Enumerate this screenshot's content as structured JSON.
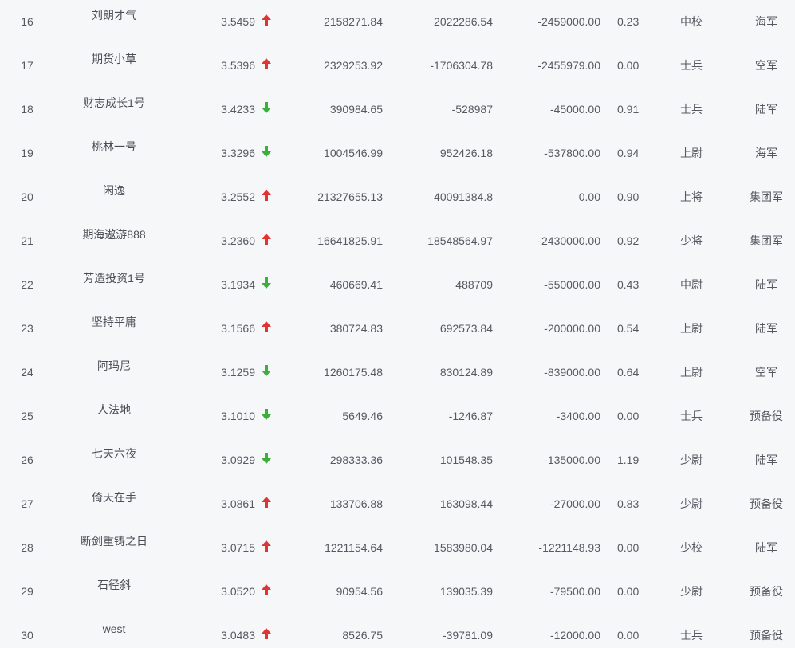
{
  "colors": {
    "up": "#e03434",
    "down": "#3ab03a",
    "text": "#555a61",
    "background": "#f6f7f9"
  },
  "rows": [
    {
      "rank": "16",
      "name": "刘朗才气",
      "score": "3.5459",
      "trend": "up",
      "equity": "2158271.84",
      "profit": "2022286.54",
      "withdraw": "-2459000.00",
      "ratio": "0.23",
      "military_rank": "中校",
      "force": "海军"
    },
    {
      "rank": "17",
      "name": "期货小草",
      "score": "3.5396",
      "trend": "up",
      "equity": "2329253.92",
      "profit": "-1706304.78",
      "withdraw": "-2455979.00",
      "ratio": "0.00",
      "military_rank": "士兵",
      "force": "空军"
    },
    {
      "rank": "18",
      "name": "财志成长1号",
      "score": "3.4233",
      "trend": "down",
      "equity": "390984.65",
      "profit": "-528987",
      "withdraw": "-45000.00",
      "ratio": "0.91",
      "military_rank": "士兵",
      "force": "陆军"
    },
    {
      "rank": "19",
      "name": "桃林一号",
      "score": "3.3296",
      "trend": "down",
      "equity": "1004546.99",
      "profit": "952426.18",
      "withdraw": "-537800.00",
      "ratio": "0.94",
      "military_rank": "上尉",
      "force": "海军"
    },
    {
      "rank": "20",
      "name": "闲逸",
      "score": "3.2552",
      "trend": "up",
      "equity": "21327655.13",
      "profit": "40091384.8",
      "withdraw": "0.00",
      "ratio": "0.90",
      "military_rank": "上将",
      "force": "集团军"
    },
    {
      "rank": "21",
      "name": "期海遨游888",
      "score": "3.2360",
      "trend": "up",
      "equity": "16641825.91",
      "profit": "18548564.97",
      "withdraw": "-2430000.00",
      "ratio": "0.92",
      "military_rank": "少将",
      "force": "集团军"
    },
    {
      "rank": "22",
      "name": "芳造投资1号",
      "score": "3.1934",
      "trend": "down",
      "equity": "460669.41",
      "profit": "488709",
      "withdraw": "-550000.00",
      "ratio": "0.43",
      "military_rank": "中尉",
      "force": "陆军"
    },
    {
      "rank": "23",
      "name": "坚持平庸",
      "score": "3.1566",
      "trend": "up",
      "equity": "380724.83",
      "profit": "692573.84",
      "withdraw": "-200000.00",
      "ratio": "0.54",
      "military_rank": "上尉",
      "force": "陆军"
    },
    {
      "rank": "24",
      "name": "阿玛尼",
      "score": "3.1259",
      "trend": "down",
      "equity": "1260175.48",
      "profit": "830124.89",
      "withdraw": "-839000.00",
      "ratio": "0.64",
      "military_rank": "上尉",
      "force": "空军"
    },
    {
      "rank": "25",
      "name": "人法地",
      "score": "3.1010",
      "trend": "down",
      "equity": "5649.46",
      "profit": "-1246.87",
      "withdraw": "-3400.00",
      "ratio": "0.00",
      "military_rank": "士兵",
      "force": "预备役"
    },
    {
      "rank": "26",
      "name": "七天六夜",
      "score": "3.0929",
      "trend": "down",
      "equity": "298333.36",
      "profit": "101548.35",
      "withdraw": "-135000.00",
      "ratio": "1.19",
      "military_rank": "少尉",
      "force": "陆军"
    },
    {
      "rank": "27",
      "name": "倚天在手",
      "score": "3.0861",
      "trend": "up",
      "equity": "133706.88",
      "profit": "163098.44",
      "withdraw": "-27000.00",
      "ratio": "0.83",
      "military_rank": "少尉",
      "force": "预备役"
    },
    {
      "rank": "28",
      "name": "断剑重铸之日",
      "score": "3.0715",
      "trend": "up",
      "equity": "1221154.64",
      "profit": "1583980.04",
      "withdraw": "-1221148.93",
      "ratio": "0.00",
      "military_rank": "少校",
      "force": "陆军"
    },
    {
      "rank": "29",
      "name": "石径斜",
      "score": "3.0520",
      "trend": "up",
      "equity": "90954.56",
      "profit": "139035.39",
      "withdraw": "-79500.00",
      "ratio": "0.00",
      "military_rank": "少尉",
      "force": "预备役"
    },
    {
      "rank": "30",
      "name": "west",
      "score": "3.0483",
      "trend": "up",
      "equity": "8526.75",
      "profit": "-39781.09",
      "withdraw": "-12000.00",
      "ratio": "0.00",
      "military_rank": "士兵",
      "force": "预备役"
    }
  ]
}
